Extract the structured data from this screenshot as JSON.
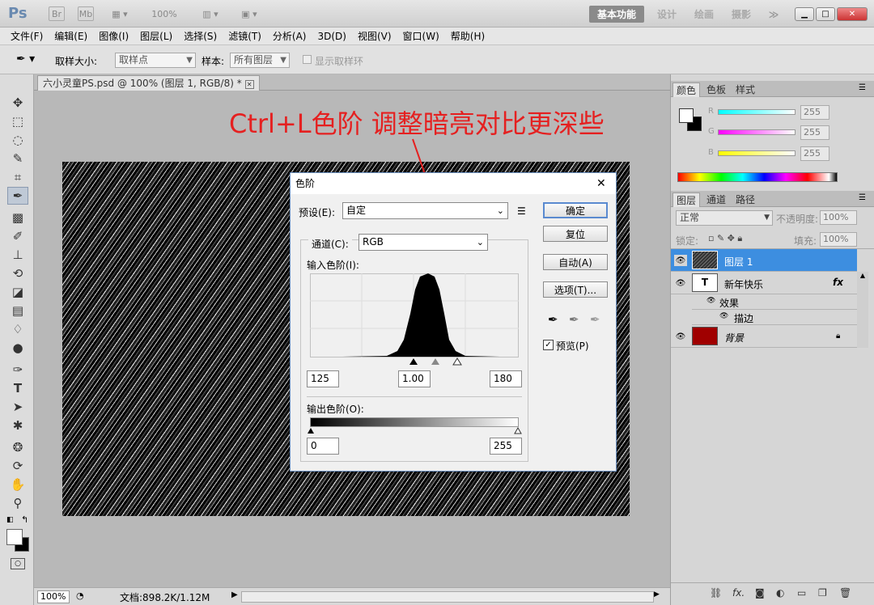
{
  "app": {
    "logo": "Ps"
  },
  "titlebar": {
    "icons": [
      "Br",
      "Mb"
    ],
    "zoom": "100%",
    "workspaces": [
      "基本功能",
      "设计",
      "绘画",
      "摄影"
    ],
    "more": "≫"
  },
  "menubar": {
    "items": [
      "文件(F)",
      "编辑(E)",
      "图像(I)",
      "图层(L)",
      "选择(S)",
      "滤镜(T)",
      "分析(A)",
      "3D(D)",
      "视图(V)",
      "窗口(W)",
      "帮助(H)"
    ]
  },
  "options": {
    "sample_size_label": "取样大小:",
    "sample_size_value": "取样点",
    "sample_label": "样本:",
    "sample_value": "所有图层",
    "show_ring": "显示取样环"
  },
  "document": {
    "tab_title": "六小灵童PS.psd @ 100% (图层 1, RGB/8) *"
  },
  "annotation": "Ctrl+L色阶 调整暗亮对比更深些",
  "levels_dialog": {
    "title": "色阶",
    "preset_label": "预设(E):",
    "preset_value": "自定",
    "channel_label": "通道(C):",
    "channel_value": "RGB",
    "input_label": "输入色阶(I):",
    "input_black": "125",
    "input_gamma": "1.00",
    "input_white": "180",
    "output_label": "输出色阶(O):",
    "output_black": "0",
    "output_white": "255",
    "buttons": {
      "ok": "确定",
      "reset": "复位",
      "auto": "自动(A)",
      "options": "选项(T)..."
    },
    "preview_label": "预览(P)",
    "preview_checked": true,
    "close": "✕"
  },
  "color_panel": {
    "tabs": [
      "颜色",
      "色板",
      "样式"
    ],
    "channels": [
      {
        "label": "R",
        "value": "255",
        "color": "#00ffff"
      },
      {
        "label": "G",
        "value": "255",
        "color": "#ff00ff"
      },
      {
        "label": "B",
        "value": "255",
        "color": "#ffff00"
      }
    ]
  },
  "layers_panel": {
    "tabs": [
      "图层",
      "通道",
      "路径"
    ],
    "blend_mode": "正常",
    "opacity_label": "不透明度:",
    "opacity_value": "100%",
    "lock_label": "锁定:",
    "fill_label": "填充:",
    "fill_value": "100%",
    "layers": [
      {
        "name": "图层 1",
        "selected": true
      },
      {
        "name": "新年快乐",
        "thumb": "T",
        "fx": "fx"
      },
      {
        "name": "效果",
        "sub": true
      },
      {
        "name": "描边",
        "sub": true
      },
      {
        "name": "背景",
        "locked": true
      }
    ]
  },
  "statusbar": {
    "zoom": "100%",
    "doc_info": "文档:898.2K/1.12M"
  }
}
